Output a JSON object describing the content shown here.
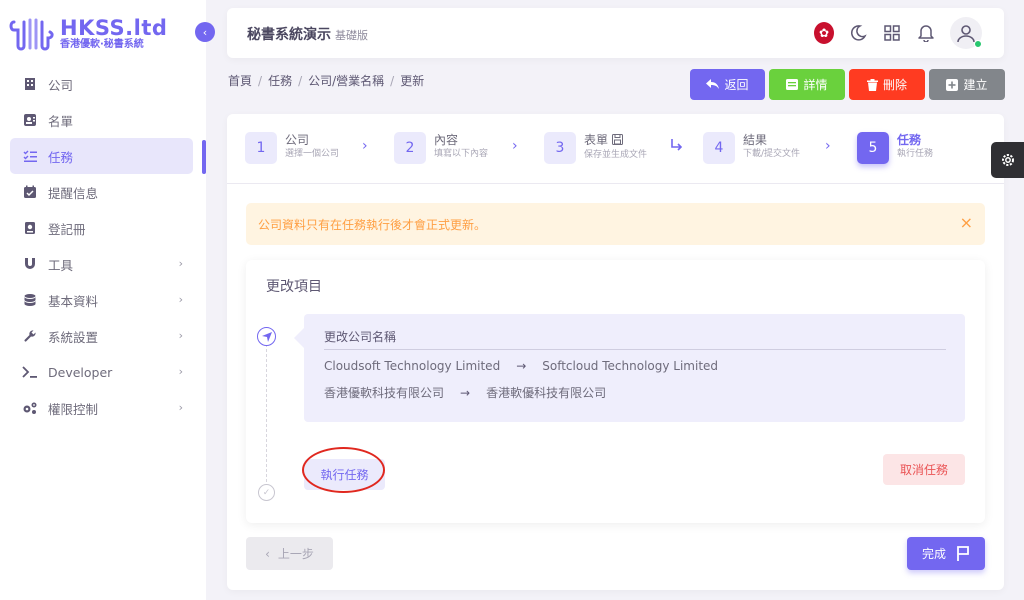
{
  "brand": {
    "title": "HKSS.ltd",
    "subtitle": "香港優軟·秘書系統"
  },
  "sidebar": {
    "items": [
      {
        "label": "公司",
        "icon": "building-icon"
      },
      {
        "label": "名單",
        "icon": "contact-card-icon"
      },
      {
        "label": "任務",
        "icon": "task-list-icon",
        "active": true
      },
      {
        "label": "提醒信息",
        "icon": "calendar-check-icon"
      },
      {
        "label": "登記冊",
        "icon": "register-book-icon"
      },
      {
        "label": "工具",
        "icon": "magnet-icon",
        "has_children": true
      },
      {
        "label": "基本資料",
        "icon": "database-icon",
        "has_children": true
      },
      {
        "label": "系統設置",
        "icon": "wrench-icon",
        "has_children": true
      },
      {
        "label": "Developer",
        "icon": "terminal-icon",
        "has_children": true
      },
      {
        "label": "權限控制",
        "icon": "gears-icon",
        "has_children": true
      }
    ]
  },
  "header": {
    "title": "秘書系統演示",
    "version": "基礎版"
  },
  "breadcrumb": [
    "首頁",
    "任務",
    "公司/營業名稱",
    "更新"
  ],
  "actions": {
    "back": {
      "label": "返回",
      "color": "#7367f0"
    },
    "details": {
      "label": "詳情",
      "color": "#6ad13d"
    },
    "delete": {
      "label": "刪除",
      "color": "#ff3b21"
    },
    "create": {
      "label": "建立",
      "color": "#82868b"
    }
  },
  "stepper": [
    {
      "num": "1",
      "title": "公司",
      "sub": "選擇一個公司"
    },
    {
      "num": "2",
      "title": "內容",
      "sub": "填寫以下內容"
    },
    {
      "num": "3",
      "title": "表單",
      "sub": "保存並生成文件"
    },
    {
      "num": "4",
      "title": "結果",
      "sub": "下載/提交文件"
    },
    {
      "num": "5",
      "title": "任務",
      "sub": "執行任務",
      "active": true
    }
  ],
  "alert": {
    "text": "公司資料只有在任務執行後才會正式更新。"
  },
  "change_section": {
    "title": "更改項目",
    "item_title": "更改公司名稱",
    "rows": [
      {
        "from": "Cloudsoft Technology Limited",
        "to": "Softcloud Technology Limited"
      },
      {
        "from": "香港優軟科技有限公司",
        "to": "香港軟優科技有限公司"
      }
    ],
    "execute_label": "執行任務",
    "cancel_label": "取消任務"
  },
  "footer": {
    "prev_label": "上一步",
    "done_label": "完成"
  },
  "colors": {
    "primary": "#7367f0",
    "warning": "#ff9f43",
    "danger": "#ea5455",
    "success": "#28c76f"
  }
}
